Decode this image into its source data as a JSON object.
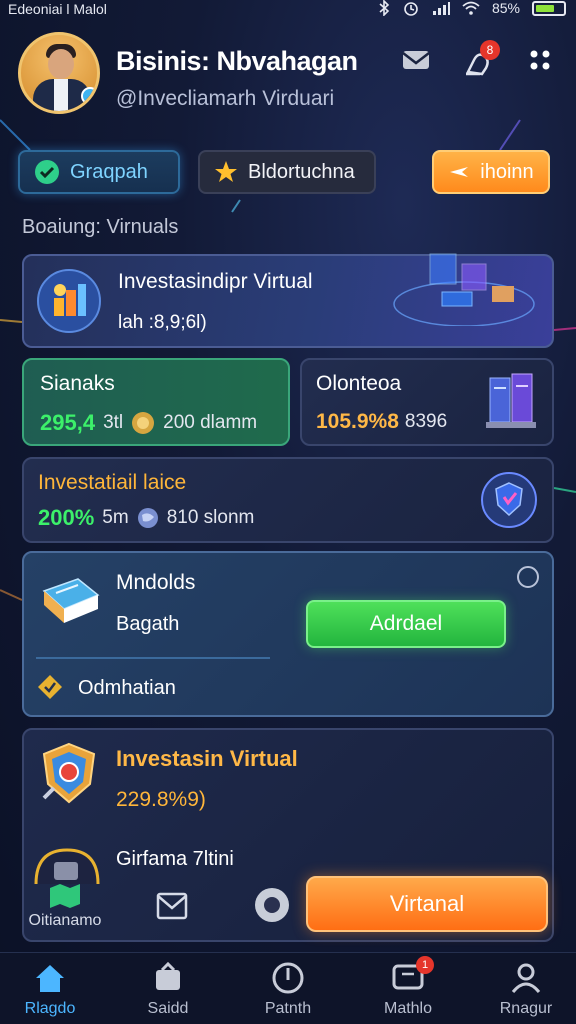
{
  "status_bar": {
    "carrier": "Edeoniai l Malol",
    "battery": "85%"
  },
  "header": {
    "title": "Bisinis: Nbvahagan",
    "subtitle": "@Invecliamarh Virduari",
    "notification_badge": "8"
  },
  "tabs": [
    {
      "label": "Graqpah"
    },
    {
      "label": "Bldortuchna"
    },
    {
      "label": "ihoinn"
    }
  ],
  "section_label": "Boaiung:  Virnuals",
  "hero_card": {
    "title": "Investasindipr Virtual",
    "value": "lah :8,9;6l)"
  },
  "stat_left": {
    "label": "Sianaks",
    "value": "295,4",
    "unit": "3tl",
    "extra": "200 dlamm"
  },
  "stat_right": {
    "label": "Olonteoa",
    "value": "105.9%8",
    "extra": "8396"
  },
  "wide_card": {
    "label": "Investatiail laice",
    "value": "200%",
    "unit": "5m",
    "extra": "810 slonm"
  },
  "book_card": {
    "title": "Mndolds",
    "subtitle": "Bagath",
    "button": "Adrdael",
    "footer": "Odmhatian"
  },
  "invest_card": {
    "title": "Investasin Virtual",
    "value": "229.8%9)",
    "sub_item": "Girfama 7ltini",
    "left_label": "Oitianamo",
    "button": "Virtanal"
  },
  "bottom_nav": [
    {
      "label": "Rlagdo",
      "icon": "home-icon"
    },
    {
      "label": "Saidd",
      "icon": "wallet-icon"
    },
    {
      "label": "Patnth",
      "icon": "power-icon"
    },
    {
      "label": "Mathlo",
      "icon": "message-icon",
      "badge": "1"
    },
    {
      "label": "Rnagur",
      "icon": "profile-icon"
    }
  ],
  "colors": {
    "accent_green": "#3cf06a",
    "accent_orange": "#ff8a1c",
    "accent_blue": "#4cb6ff",
    "background": "#121a36"
  }
}
